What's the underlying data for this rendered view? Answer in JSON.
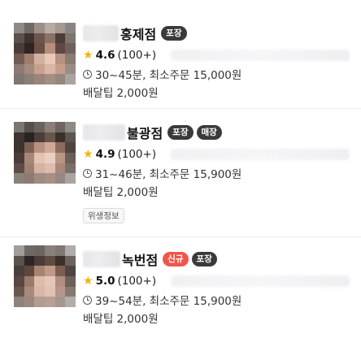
{
  "stores": [
    {
      "name": "홍제점",
      "badges": [
        {
          "label": "포장",
          "type": "takeout"
        }
      ],
      "rating": "4.6",
      "review_count": "(100+)",
      "delivery_time": "30~45분, 최소주문 15,000원",
      "delivery_tip": "배달팁 2,000원",
      "thumb_colors": [
        "#8e8a86",
        "#6f6a66",
        "#9a8f88",
        "#b8aaa0",
        "#a49a93",
        "#8a8582",
        "#5b524c",
        "#3e3330",
        "#6a564c",
        "#8a7366",
        "#4a3c36",
        "#7d7470",
        "#4a3d37",
        "#2d2522",
        "#6c4e44",
        "#b58e7e",
        "#5c4a42",
        "#6e615c",
        "#725b50",
        "#a07c6e",
        "#d3b1a2",
        "#e8c8b8",
        "#b69180",
        "#8a7b73",
        "#8d7a72",
        "#a68a7e",
        "#c7a090",
        "#d9b6a6",
        "#c49e8d",
        "#9a8c86",
        "#7e7672",
        "#8b7f7a",
        "#9b8479",
        "#a68d82",
        "#958680",
        "#a9a3a0"
      ]
    },
    {
      "name": "불광점",
      "badges": [
        {
          "label": "포장",
          "type": "takeout"
        },
        {
          "label": "매장",
          "type": "dinein"
        }
      ],
      "rating": "4.9",
      "review_count": "(100+)",
      "delivery_time": "31~46분, 최소주문 15,900원",
      "delivery_tip": "배달팁 2,000원",
      "hygiene_label": "위생정보",
      "thumb_colors": [
        "#7a7672",
        "#56504c",
        "#6a625d",
        "#8a7f78",
        "#6e6560",
        "#8d8985",
        "#3e3532",
        "#2a2220",
        "#4c3e38",
        "#6b564c",
        "#3b302c",
        "#5c5552",
        "#3c322e",
        "#7e6156",
        "#b99181",
        "#d1a896",
        "#8b6c5f",
        "#4e4541",
        "#4a3c36",
        "#a88676",
        "#e3c3b4",
        "#eccfc1",
        "#b89585",
        "#6a5e59",
        "#5d4d46",
        "#9c8072",
        "#d4b3a4",
        "#dbbcad",
        "#a8887a",
        "#7a6e69",
        "#8a817c",
        "#8c7b73",
        "#a28b80",
        "#a99085",
        "#978780",
        "#a9a4a0"
      ]
    },
    {
      "name": "녹번점",
      "badges": [
        {
          "label": "신규",
          "type": "new"
        },
        {
          "label": "포장",
          "type": "takeout"
        }
      ],
      "rating": "5.0",
      "review_count": "(100+)",
      "delivery_time": "39~54분, 최소주문 15,900원",
      "delivery_tip": "배달팁 2,000원",
      "thumb_colors": [
        "#a09d9a",
        "#706a66",
        "#6d6560",
        "#8a807a",
        "#7f7773",
        "#b0aca9",
        "#5a524e",
        "#2e2624",
        "#4a3c36",
        "#5f4b42",
        "#3a302c",
        "#6a6360",
        "#4a3f3a",
        "#5e473e",
        "#a78372",
        "#c09a88",
        "#7c5f52",
        "#4e4542",
        "#58483f",
        "#9c7a6a",
        "#dcbcac",
        "#e6c6b6",
        "#b18e7e",
        "#6c605b",
        "#6a574e",
        "#a78a7c",
        "#d8b7a8",
        "#e0c2b3",
        "#b4978a",
        "#857873",
        "#8d827d",
        "#9a8880",
        "#b39c91",
        "#b8a095",
        "#a59690",
        "#b3aeaa"
      ]
    }
  ]
}
